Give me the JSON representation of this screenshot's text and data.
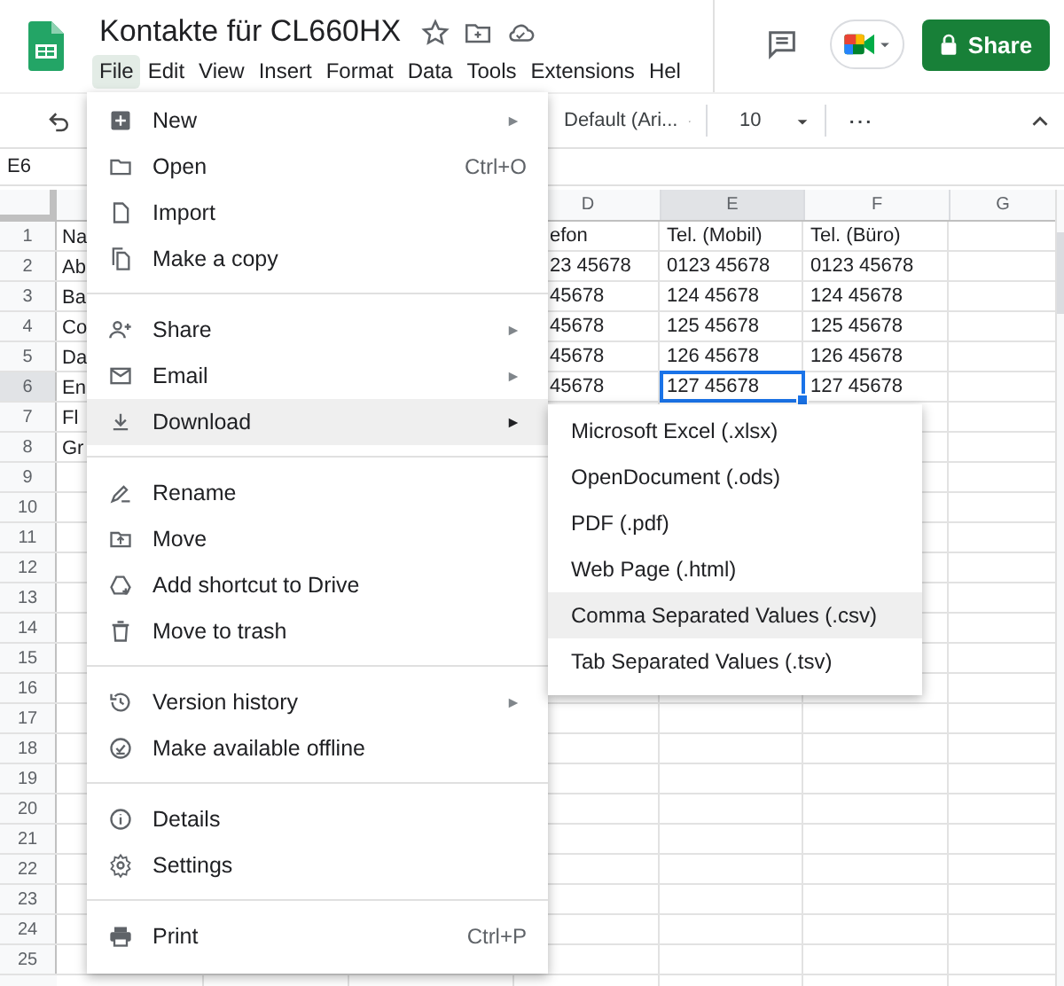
{
  "document": {
    "title": "Kontakte für CL660HX"
  },
  "menubar": [
    {
      "label": "File",
      "selected": true
    },
    {
      "label": "Edit",
      "selected": false
    },
    {
      "label": "View",
      "selected": false
    },
    {
      "label": "Insert",
      "selected": false
    },
    {
      "label": "Format",
      "selected": false
    },
    {
      "label": "Data",
      "selected": false
    },
    {
      "label": "Tools",
      "selected": false
    },
    {
      "label": "Extensions",
      "selected": false
    },
    {
      "label": "Hel",
      "selected": false
    }
  ],
  "share_button": "Share",
  "toolbar": {
    "font": "Default (Ari...",
    "font_size": "10",
    "more": "⋯"
  },
  "name_box": "E6",
  "table": {
    "columns": [
      {
        "label": "D",
        "selected": false
      },
      {
        "label": "E",
        "selected": true
      },
      {
        "label": "F",
        "selected": false
      },
      {
        "label": "G",
        "selected": false
      }
    ],
    "rows": [
      {
        "number": "1",
        "selected": false,
        "first_cell": "Na",
        "cells": [
          {
            "text": "efon",
            "selected": false
          },
          {
            "text": "Tel. (Mobil)",
            "selected": false
          },
          {
            "text": "Tel. (Büro)",
            "selected": false
          }
        ]
      },
      {
        "number": "2",
        "selected": false,
        "first_cell": "Ab",
        "cells": [
          {
            "text": "23 45678",
            "selected": false
          },
          {
            "text": "0123 45678",
            "selected": false
          },
          {
            "text": "0123 45678",
            "selected": false
          }
        ]
      },
      {
        "number": "3",
        "selected": false,
        "first_cell": "Ba",
        "cells": [
          {
            "text": "45678",
            "selected": false
          },
          {
            "text": "124 45678",
            "selected": false
          },
          {
            "text": "124 45678",
            "selected": false
          }
        ]
      },
      {
        "number": "4",
        "selected": false,
        "first_cell": "Co",
        "cells": [
          {
            "text": "45678",
            "selected": false
          },
          {
            "text": "125 45678",
            "selected": false
          },
          {
            "text": "125 45678",
            "selected": false
          }
        ]
      },
      {
        "number": "5",
        "selected": false,
        "first_cell": "Da",
        "cells": [
          {
            "text": "45678",
            "selected": false
          },
          {
            "text": "126 45678",
            "selected": false
          },
          {
            "text": "126 45678",
            "selected": false
          }
        ]
      },
      {
        "number": "6",
        "selected": true,
        "first_cell": "En",
        "cells": [
          {
            "text": "45678",
            "selected": false
          },
          {
            "text": "127 45678",
            "selected": true
          },
          {
            "text": "127 45678",
            "selected": false
          }
        ]
      },
      {
        "number": "7",
        "selected": false,
        "first_cell": "Fl",
        "cells": []
      },
      {
        "number": "8",
        "selected": false,
        "first_cell": "Gr",
        "cells": []
      },
      {
        "number": "9",
        "selected": false,
        "cells": []
      },
      {
        "number": "10",
        "selected": false,
        "cells": []
      },
      {
        "number": "11",
        "selected": false,
        "cells": []
      },
      {
        "number": "12",
        "selected": false,
        "cells": []
      },
      {
        "number": "13",
        "selected": false,
        "cells": []
      },
      {
        "number": "14",
        "selected": false,
        "cells": []
      },
      {
        "number": "15",
        "selected": false,
        "cells": []
      },
      {
        "number": "16",
        "selected": false,
        "cells": []
      },
      {
        "number": "17",
        "selected": false,
        "cells": []
      },
      {
        "number": "18",
        "selected": false,
        "cells": []
      },
      {
        "number": "19",
        "selected": false,
        "cells": []
      },
      {
        "number": "20",
        "selected": false,
        "cells": []
      },
      {
        "number": "21",
        "selected": false,
        "cells": []
      },
      {
        "number": "22",
        "selected": false,
        "cells": []
      },
      {
        "number": "23",
        "selected": false,
        "cells": []
      },
      {
        "number": "24",
        "selected": false,
        "cells": []
      },
      {
        "number": "25",
        "selected": false,
        "cells": []
      }
    ]
  },
  "file_menu": {
    "sections": [
      [
        {
          "label": "New",
          "has_submenu": true,
          "highlighted": false
        },
        {
          "label": "Open",
          "shortcut": "Ctrl+O",
          "has_submenu": false,
          "highlighted": false
        },
        {
          "label": "Import",
          "has_submenu": false,
          "highlighted": false
        },
        {
          "label": "Make a copy",
          "has_submenu": false,
          "highlighted": false
        }
      ],
      [
        {
          "label": "Share",
          "has_submenu": true,
          "highlighted": false
        },
        {
          "label": "Email",
          "has_submenu": true,
          "highlighted": false
        },
        {
          "label": "Download",
          "has_submenu": true,
          "highlighted": true
        }
      ],
      [
        {
          "label": "Rename",
          "has_submenu": false,
          "highlighted": false
        },
        {
          "label": "Move",
          "has_submenu": false,
          "highlighted": false
        },
        {
          "label": "Add shortcut to Drive",
          "has_submenu": false,
          "highlighted": false
        },
        {
          "label": "Move to trash",
          "has_submenu": false,
          "highlighted": false
        }
      ],
      [
        {
          "label": "Version history",
          "has_submenu": true,
          "highlighted": false
        },
        {
          "label": "Make available offline",
          "has_submenu": false,
          "highlighted": false
        }
      ],
      [
        {
          "label": "Details",
          "has_submenu": false,
          "highlighted": false
        },
        {
          "label": "Settings",
          "has_submenu": false,
          "highlighted": false
        }
      ],
      [
        {
          "label": "Print",
          "shortcut": "Ctrl+P",
          "has_submenu": false,
          "highlighted": false
        }
      ]
    ]
  },
  "download_submenu": [
    {
      "label": "Microsoft Excel (.xlsx)",
      "highlighted": false
    },
    {
      "label": "OpenDocument (.ods)",
      "highlighted": false
    },
    {
      "label": "PDF (.pdf)",
      "highlighted": false
    },
    {
      "label": "Web Page (.html)",
      "highlighted": false
    },
    {
      "label": "Comma Separated Values (.csv)",
      "highlighted": true
    },
    {
      "label": "Tab Separated Values (.tsv)",
      "highlighted": false
    }
  ]
}
